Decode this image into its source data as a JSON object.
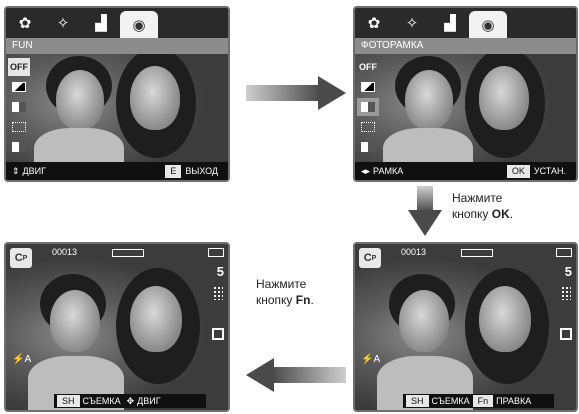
{
  "screen1": {
    "menu_title": "FUN",
    "item_off": "OFF",
    "nav_label": "ДВИГ",
    "exit_key": "E",
    "exit_label": "ВЫХОД"
  },
  "screen2": {
    "menu_title": "ФОТОРАМКА",
    "item_off": "OFF",
    "nav_label": "РАМКА",
    "ok_key": "OK",
    "set_label": "УСТАН."
  },
  "screen3": {
    "shot_count": "00013",
    "size": "5",
    "shutter_key": "SH",
    "shoot_label": "СЪЕМКА",
    "move_label": "ДВИГ"
  },
  "screen4": {
    "shot_count": "00013",
    "size": "5",
    "shutter_key": "SH",
    "shoot_label": "СЪЕМКА",
    "fn_key": "Fn",
    "edit_label": "ПРАВКА"
  },
  "captions": {
    "press_ok_line1": "Нажмите",
    "press_ok_line2": "кнопку ",
    "press_ok_key": "OK",
    "press_fn_line1": "Нажмите",
    "press_fn_line2": "кнопку ",
    "press_fn_key": "Fn"
  },
  "icons": [
    "palette-icon",
    "sparkle-icon",
    "histogram-icon",
    "camera-tab-icon",
    "arrow-right-icon",
    "arrow-down-icon",
    "arrow-left-icon"
  ]
}
